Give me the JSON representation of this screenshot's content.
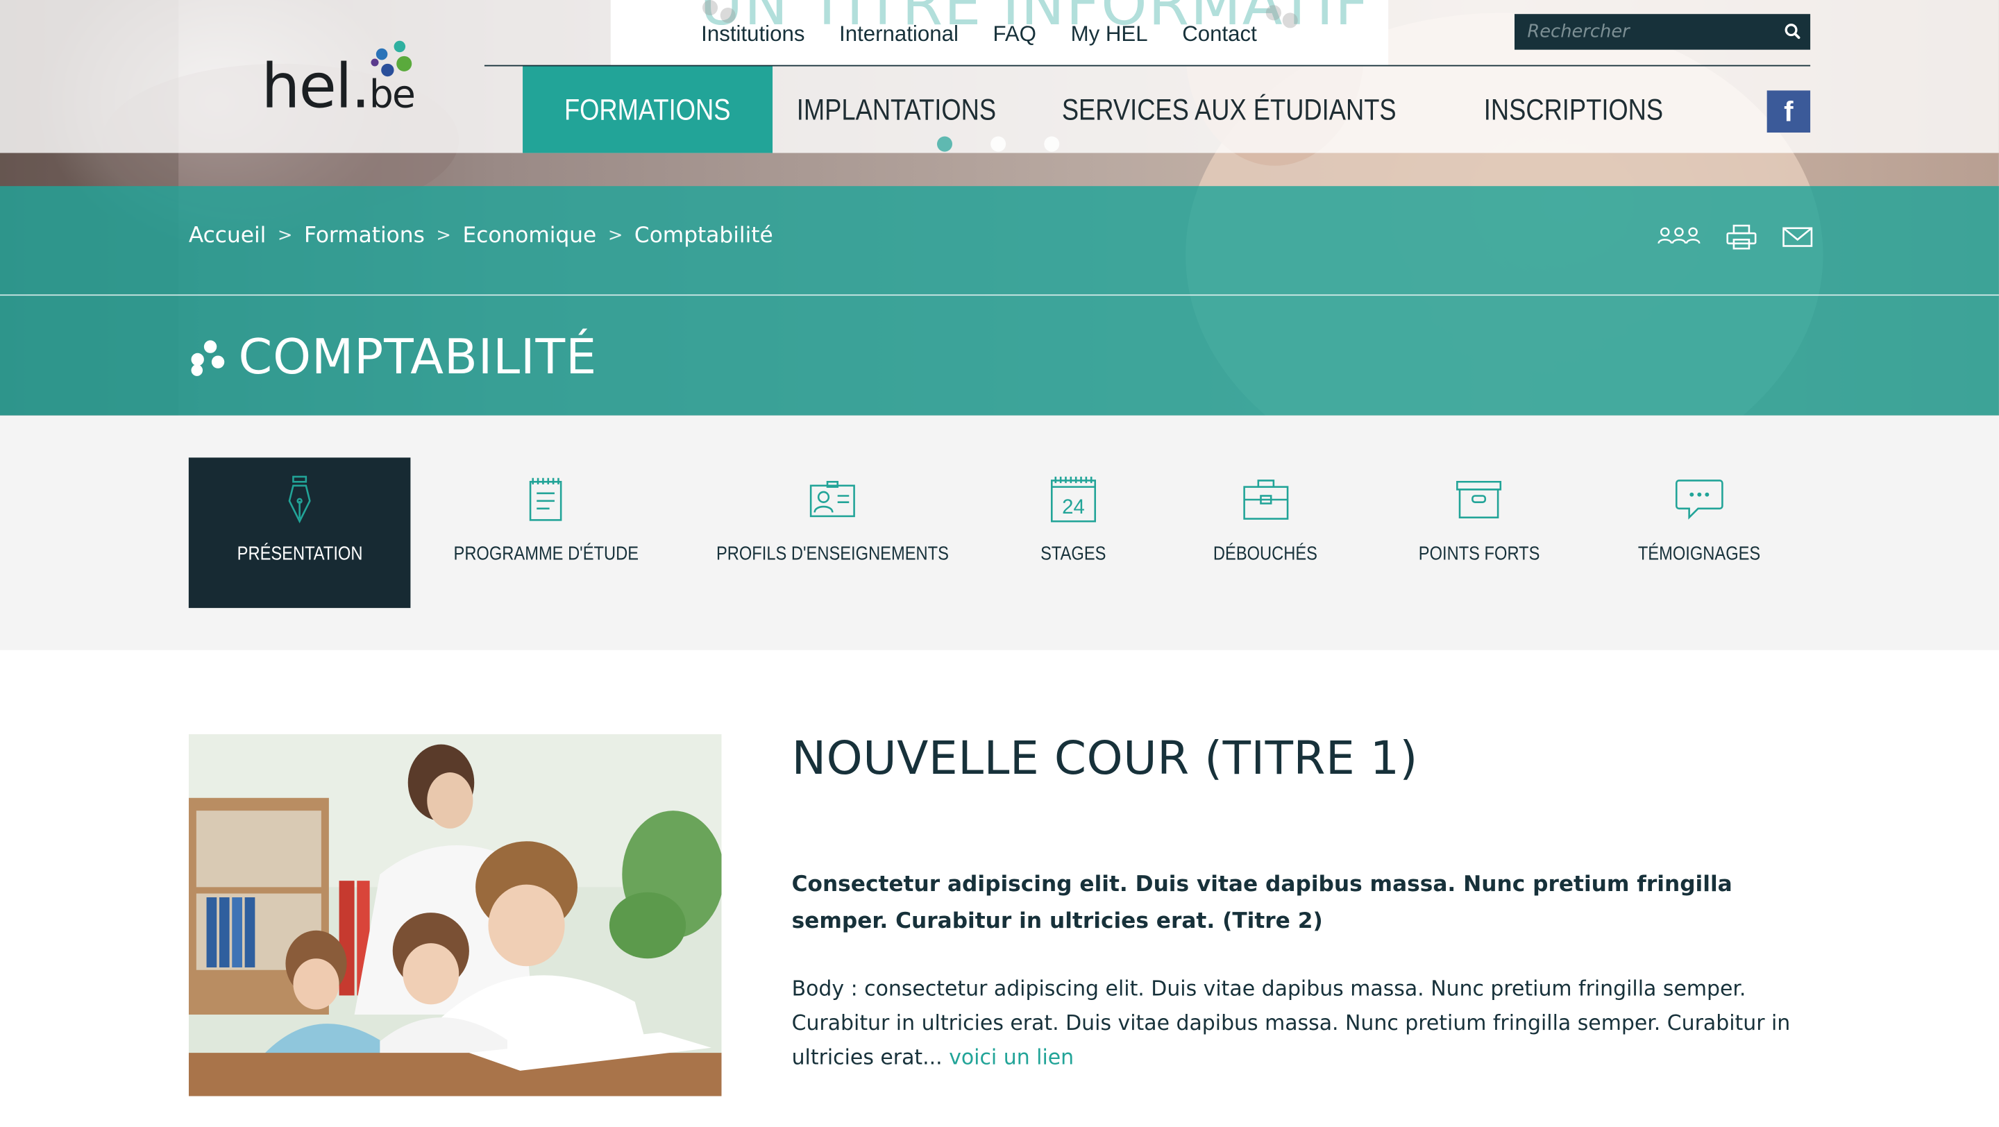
{
  "site": {
    "logo_text_main": "hel",
    "logo_text_dot": ".",
    "logo_text_tld": "be"
  },
  "slider": {
    "ghost_title": "UN TITRE INFORMATIF",
    "dots_count": 3,
    "active_dot": 0
  },
  "top_nav": {
    "items": [
      {
        "label": "Institutions"
      },
      {
        "label": "International"
      },
      {
        "label": "FAQ"
      },
      {
        "label": "My HEL"
      },
      {
        "label": "Contact"
      }
    ]
  },
  "search": {
    "placeholder": "Rechercher",
    "icon": "search-icon"
  },
  "main_nav": {
    "items": [
      {
        "label": "FORMATIONS",
        "active": true
      },
      {
        "label": "IMPLANTATIONS"
      },
      {
        "label": "SERVICES AUX ÉTUDIANTS"
      },
      {
        "label": "INSCRIPTIONS"
      }
    ],
    "social": {
      "label": "f",
      "icon": "facebook-icon"
    }
  },
  "breadcrumb": {
    "items": [
      "Accueil",
      "Formations",
      "Economique",
      "Comptabilité"
    ],
    "separator": ">"
  },
  "tools": [
    "group-icon",
    "print-icon",
    "mail-icon"
  ],
  "page": {
    "title": "COMPTABILITÉ"
  },
  "tabs": {
    "items": [
      {
        "label": "PRÉSENTATION",
        "icon": "pen-nib-icon",
        "active": true
      },
      {
        "label": "PROGRAMME D'ÉTUDE",
        "icon": "notepad-icon"
      },
      {
        "label": "PROFILS D'ENSEIGNEMENTS",
        "icon": "id-card-icon"
      },
      {
        "label": "STAGES",
        "icon": "calendar-icon",
        "calendar_day": "24"
      },
      {
        "label": "DÉBOUCHÉS",
        "icon": "briefcase-icon"
      },
      {
        "label": "POINTS FORTS",
        "icon": "archive-box-icon"
      },
      {
        "label": "TÉMOIGNAGES",
        "icon": "speech-bubble-icon"
      }
    ]
  },
  "article": {
    "heading": "NOUVELLE COUR (TITRE 1)",
    "subheading": "Consectetur adipiscing elit. Duis vitae dapibus massa. Nunc pretium fringilla semper. Curabitur in ultricies erat. (Titre 2)",
    "body": "Body : consectetur adipiscing elit. Duis vitae dapibus massa. Nunc pretium fringilla semper. Curabitur in ultricies erat. Duis vitae dapibus massa. Nunc pretium fringilla semper. Curabitur in ultricies erat... ",
    "link_label": "voici un lien"
  },
  "colors": {
    "teal": "#22a498",
    "dark": "#17313a",
    "facebook": "#3b5a99",
    "band": "#f4f4f4"
  }
}
